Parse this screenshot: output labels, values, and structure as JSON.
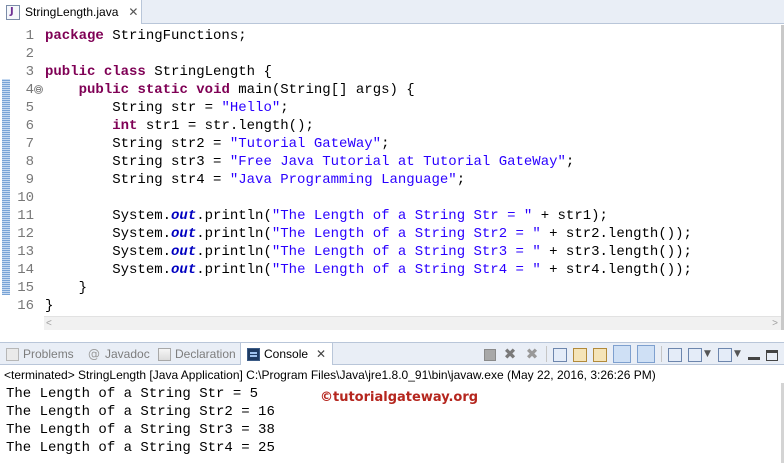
{
  "editor": {
    "tab": {
      "title": "StringLength.java",
      "close": "✕"
    },
    "lines": [
      {
        "n": "1",
        "parts": [
          [
            "kw",
            "package"
          ],
          [
            "t",
            " StringFunctions;"
          ]
        ]
      },
      {
        "n": "2",
        "parts": []
      },
      {
        "n": "3",
        "parts": [
          [
            "kw",
            "public"
          ],
          [
            "t",
            " "
          ],
          [
            "kw",
            "class"
          ],
          [
            "t",
            " StringLength {"
          ]
        ]
      },
      {
        "n": "4",
        "fold": "⊖",
        "parts": [
          [
            "t",
            "    "
          ],
          [
            "kw",
            "public"
          ],
          [
            "t",
            " "
          ],
          [
            "kw",
            "static"
          ],
          [
            "t",
            " "
          ],
          [
            "kw",
            "void"
          ],
          [
            "t",
            " main(String[] args) {"
          ]
        ]
      },
      {
        "n": "5",
        "parts": [
          [
            "t",
            "        String str = "
          ],
          [
            "str",
            "\"Hello\""
          ],
          [
            "t",
            ";"
          ]
        ]
      },
      {
        "n": "6",
        "parts": [
          [
            "t",
            "        "
          ],
          [
            "kw",
            "int"
          ],
          [
            "t",
            " str1 = str.length();"
          ]
        ]
      },
      {
        "n": "7",
        "parts": [
          [
            "t",
            "        String str2 = "
          ],
          [
            "str",
            "\"Tutorial GateWay\""
          ],
          [
            "t",
            ";"
          ]
        ]
      },
      {
        "n": "8",
        "parts": [
          [
            "t",
            "        String str3 = "
          ],
          [
            "str",
            "\"Free Java Tutorial at Tutorial GateWay\""
          ],
          [
            "t",
            ";"
          ]
        ]
      },
      {
        "n": "9",
        "parts": [
          [
            "t",
            "        String str4 = "
          ],
          [
            "str",
            "\"Java Programming Language\""
          ],
          [
            "t",
            ";"
          ]
        ]
      },
      {
        "n": "10",
        "parts": []
      },
      {
        "n": "11",
        "parts": [
          [
            "t",
            "        System."
          ],
          [
            "fld",
            "out"
          ],
          [
            "t",
            ".println("
          ],
          [
            "str",
            "\"The Length of a String Str = \""
          ],
          [
            "t",
            " + str1);"
          ]
        ]
      },
      {
        "n": "12",
        "parts": [
          [
            "t",
            "        System."
          ],
          [
            "fld",
            "out"
          ],
          [
            "t",
            ".println("
          ],
          [
            "str",
            "\"The Length of a String Str2 = \""
          ],
          [
            "t",
            " + str2.length());"
          ]
        ]
      },
      {
        "n": "13",
        "parts": [
          [
            "t",
            "        System."
          ],
          [
            "fld",
            "out"
          ],
          [
            "t",
            ".println("
          ],
          [
            "str",
            "\"The Length of a String Str3 = \""
          ],
          [
            "t",
            " + str3.length());"
          ]
        ]
      },
      {
        "n": "14",
        "parts": [
          [
            "t",
            "        System."
          ],
          [
            "fld",
            "out"
          ],
          [
            "t",
            ".println("
          ],
          [
            "str",
            "\"The Length of a String Str4 = \""
          ],
          [
            "t",
            " + str4.length());"
          ]
        ]
      },
      {
        "n": "15",
        "parts": [
          [
            "t",
            "    }"
          ]
        ]
      },
      {
        "n": "16",
        "parts": [
          [
            "t",
            "}"
          ]
        ]
      }
    ],
    "scroll_left": "<",
    "scroll_right": ">"
  },
  "views": {
    "tabs": [
      {
        "label": "Problems",
        "icon": "problems-icon"
      },
      {
        "label": "Javadoc",
        "icon": "javadoc-icon",
        "glyph": "@"
      },
      {
        "label": "Declaration",
        "icon": "declaration-icon"
      },
      {
        "label": "Console",
        "icon": "console-icon",
        "close": "✕"
      }
    ],
    "toolbar": {
      "terminate": "stop-icon",
      "remove": "✖",
      "remove_all": "✖",
      "dropdown": "▼"
    }
  },
  "console": {
    "status": "<terminated> StringLength [Java Application] C:\\Program Files\\Java\\jre1.8.0_91\\bin\\javaw.exe (May 22, 2016, 3:26:26 PM)",
    "output": [
      "The Length of a String Str = 5",
      "The Length of a String Str2 = 16",
      "The Length of a String Str3 = 38",
      "The Length of a String Str4 = 25"
    ],
    "watermark": "©tutorialgateway.org"
  },
  "colors": {
    "keyword": "#7f0055",
    "string": "#2a00ff",
    "field": "#0000c0",
    "watermark": "#b5261e"
  }
}
